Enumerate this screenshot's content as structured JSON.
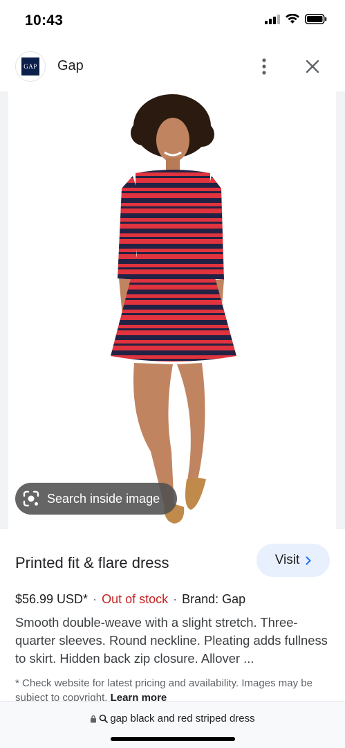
{
  "status_bar": {
    "time": "10:43",
    "icons": [
      "cellular-signal-icon",
      "wifi-icon",
      "battery-icon"
    ]
  },
  "header": {
    "site_logo_text": "GAP",
    "site_name": "Gap",
    "more_icon": "more-vert-icon",
    "close_icon": "close-icon"
  },
  "image": {
    "subject": "woman-in-striped-dress-photo",
    "colors": {
      "stripe_red": "#e0333d",
      "stripe_navy": "#1f1f3d",
      "skin": "#c08560",
      "hair": "#2a1a10",
      "shoes": "#c08a4a"
    }
  },
  "lens_chip": {
    "icon": "lens-icon",
    "label": "Search inside image"
  },
  "product": {
    "title": "Printed fit & flare dress",
    "price": "$56.99 USD*",
    "stock_status": "Out of stock",
    "brand": "Brand: Gap",
    "description": "Smooth double-weave with a slight stretch. Three-quarter sleeves. Round neckline. Pleating adds fullness to skirt. Hidden back zip closure. Allover ...",
    "disclaimer": "* Check website for latest pricing and availability. Images may be subject to copyright.",
    "learn_more": "Learn more"
  },
  "visit_button": {
    "label": "Visit",
    "icon": "chevron-right-icon"
  },
  "bottom_bar": {
    "query": "gap black and red striped dress",
    "icons": [
      "lock-icon",
      "search-icon"
    ]
  },
  "colors": {
    "accent_blue": "#1a73e8",
    "visit_bg": "#e8f0fe",
    "stock_red": "#c5221f"
  }
}
